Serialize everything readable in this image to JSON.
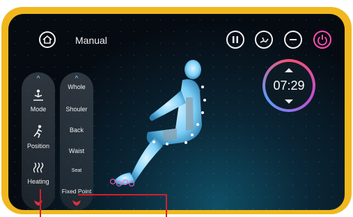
{
  "header": {
    "title": "Manual"
  },
  "mode_menu": {
    "items": [
      {
        "label": "Mode",
        "icon": "meditation-icon"
      },
      {
        "label": "Position",
        "icon": "person-walk-icon"
      },
      {
        "label": "Heating",
        "icon": "heat-waves-icon"
      }
    ]
  },
  "area_menu": {
    "items": [
      "Whole",
      "Shouler",
      "Back",
      "Waist",
      "Seat",
      "Fixed Point"
    ]
  },
  "timer": {
    "value": "07:29"
  },
  "colors": {
    "frame": "#f0b81e",
    "power_accent": "#ff4fb0",
    "callout_line": "#d51f2a",
    "body_glow": "#7fd0f7"
  }
}
